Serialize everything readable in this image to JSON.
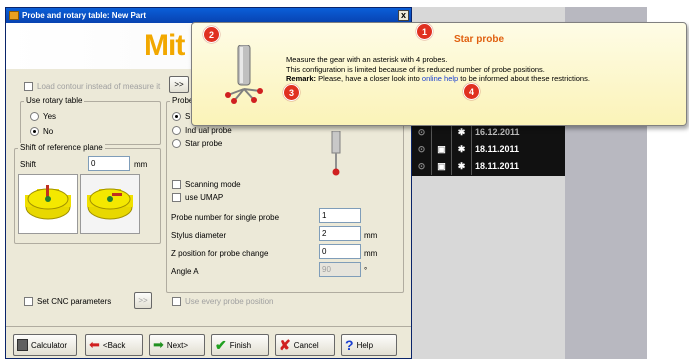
{
  "window": {
    "title": "Probe and rotary table: New Part",
    "close": "x"
  },
  "banner": {
    "logo": "Mit"
  },
  "top": {
    "load_contour": "Load contour instead of measure it",
    "arrow_btn": ">>"
  },
  "rotary": {
    "heading": "Use rotary table",
    "yes": "Yes",
    "no": "No",
    "selected": "No"
  },
  "shift": {
    "heading": "Shift of reference plane",
    "label": "Shift",
    "value": "0",
    "unit": "mm"
  },
  "probe": {
    "heading": "Probe",
    "opt1": "S",
    "opt2": "Ind      ual probe",
    "opt3": "Star probe",
    "scanning": "Scanning mode",
    "umap": "use UMAP",
    "fields": [
      {
        "label": "Probe number for single probe",
        "value": "1",
        "unit": ""
      },
      {
        "label": "Stylus diameter",
        "value": "2",
        "unit": "mm"
      },
      {
        "label": "Z position for probe change",
        "value": "0",
        "unit": "mm"
      },
      {
        "label": "Angle A",
        "value": "90",
        "unit": "°"
      }
    ]
  },
  "cnc": {
    "label": "Set CNC parameters",
    "btn": ">>",
    "every_probe": "Use every probe position"
  },
  "buttons": {
    "calc": "Calculator",
    "back": "<Back",
    "next": "Next>",
    "finish": "Finish",
    "cancel": "Cancel",
    "help": "Help"
  },
  "table": {
    "rows": [
      {
        "date": "16.12.2011"
      },
      {
        "date": "18.11.2011"
      },
      {
        "date": "18.11.2011"
      }
    ]
  },
  "tooltip": {
    "title": "Star probe",
    "line1": "Measure the gear with an asterisk with 4 probes.",
    "line2": "This configuration is limited because of its reduced number of probe positions.",
    "remark_label": "Remark:",
    "remark_text": " Please, have a closer look into ",
    "link": "online help",
    "remark_end": " to be informed about these restrictions.",
    "badges": [
      "1",
      "2",
      "3",
      "4"
    ]
  },
  "colors": {
    "accent": "#e06010",
    "badge": "#e03020",
    "logo": "#f2a800",
    "link": "#1a3fd0"
  }
}
